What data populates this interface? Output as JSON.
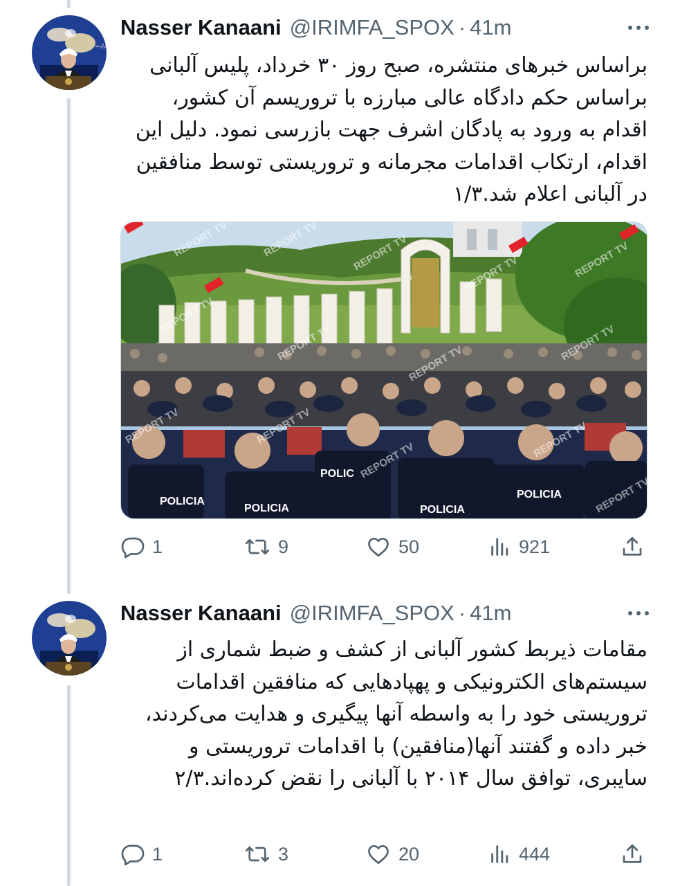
{
  "tweets": [
    {
      "author_name": "Nasser Kanaani",
      "handle": "@IRIMFA_SPOX",
      "separator": "·",
      "time": "41m",
      "text": "براساس خبرهای منتشره، صبح روز ۳۰ خرداد، پلیس آلبانی براساس حکم دادگاه عالی مبارزه با تروریسم آن کشور، اقدام به ورود به پادگان اشرف جهت بازرسی نمود. دلیل این اقدام، ارتکاب اقدامات مجرمانه و تروریستی توسط منافقین در آلبانی اعلام شد.۱/۳",
      "media": {
        "watermark": "REPORT TV",
        "vest_text": "POLICIA",
        "vest_text_short": "POLIC"
      },
      "replies": "1",
      "retweets": "9",
      "likes": "50",
      "views": "921"
    },
    {
      "author_name": "Nasser Kanaani",
      "handle": "@IRIMFA_SPOX",
      "separator": "·",
      "time": "41m",
      "text": "مقامات ذیربط کشور آلبانی از کشف و ضبط شماری از سیستم‌های الکترونیکی و پهپادهایی که منافقین اقدامات تروریستی خود را به واسطه آنها پیگیری و هدایت می‌کردند، خبر داده و گفتند آنها(منافقین) با اقدامات تروریستی و سایبری، توافق سال ۲۰۱۴ با آلبانی را نقض کرده‌اند.۲/۳",
      "replies": "1",
      "retweets": "3",
      "likes": "20",
      "views": "444"
    }
  ],
  "icons": {
    "more": "more-horizontal-icon",
    "reply": "reply-icon",
    "retweet": "retweet-icon",
    "like": "heart-icon",
    "views": "views-icon",
    "share": "share-icon"
  },
  "colors": {
    "text": "#0f1419",
    "secondary": "#536471",
    "thread_line": "#cfd9de",
    "watermark_red": "#e0242a"
  }
}
